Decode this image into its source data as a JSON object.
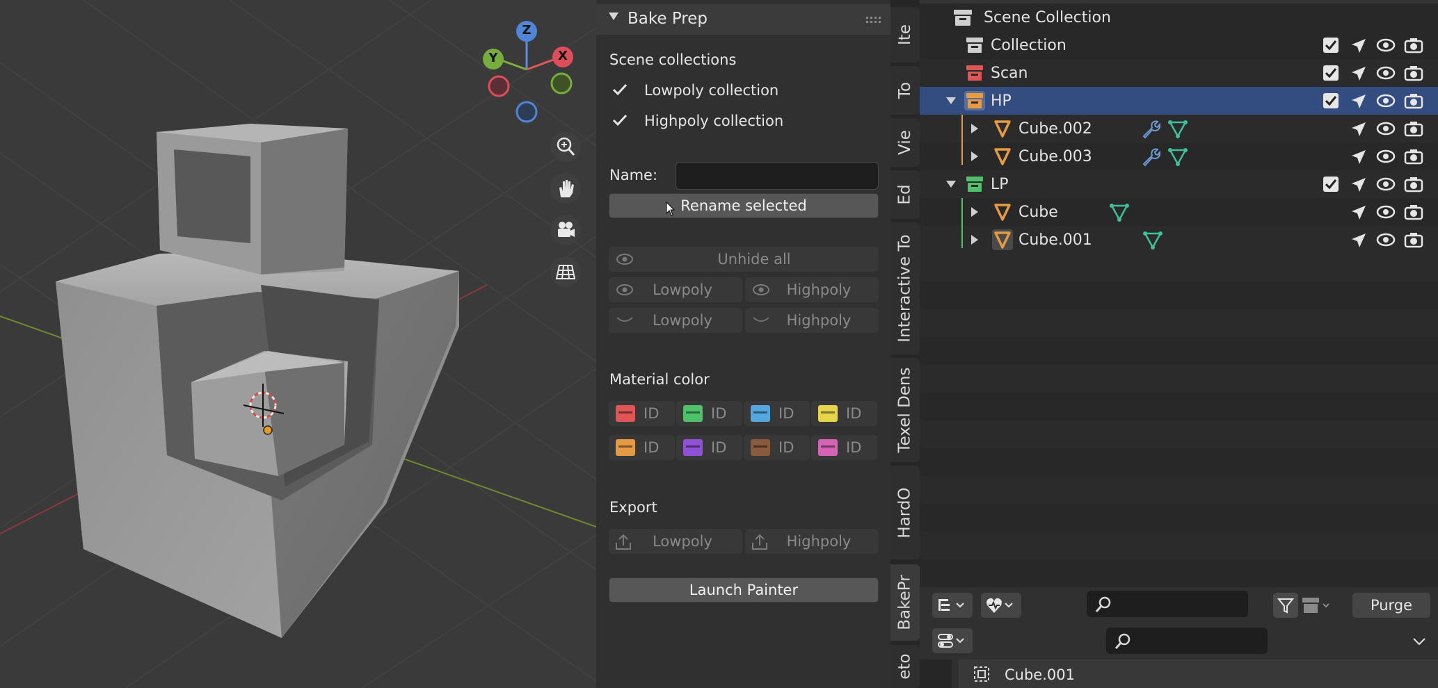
{
  "panel": {
    "title": "Bake Prep",
    "scene_collections_label": "Scene collections",
    "lowpoly_collection": "Lowpoly collection",
    "highpoly_collection": "Highpoly collection",
    "name_label": "Name:",
    "name_value": "",
    "rename_button": "Rename selected",
    "unhide_all": "Unhide all",
    "show_lowpoly": "Lowpoly",
    "show_highpoly": "Highpoly",
    "hide_lowpoly": "Lowpoly",
    "hide_highpoly": "Highpoly",
    "material_color_label": "Material color",
    "id_label": "ID",
    "material_colors": [
      "#e05555",
      "#4fc16a",
      "#55a7e0",
      "#e6d44a",
      "#e79a44",
      "#8f52d6",
      "#8a5a3c",
      "#d664b5"
    ],
    "export_label": "Export",
    "export_lowpoly": "Lowpoly",
    "export_highpoly": "Highpoly",
    "launch_button": "Launch Painter"
  },
  "tabs": [
    "Ite",
    "To",
    "Vie",
    "Ed",
    "Interactive To",
    "Texel Dens",
    "HardO",
    "BakePr",
    "eto"
  ],
  "outliner": {
    "scene_collection": "Scene Collection",
    "rows": [
      {
        "name": "Collection",
        "kind": "collection",
        "color": "#cfcfcf"
      },
      {
        "name": "Scan",
        "kind": "collection",
        "color": "#e05555"
      },
      {
        "name": "HP",
        "kind": "collection",
        "color": "#e79a44",
        "selected": true
      },
      {
        "name": "Cube.002",
        "kind": "mesh",
        "color": "#e79a44"
      },
      {
        "name": "Cube.003",
        "kind": "mesh",
        "color": "#e79a44"
      },
      {
        "name": "LP",
        "kind": "collection",
        "color": "#4fc16a"
      },
      {
        "name": "Cube",
        "kind": "mesh",
        "color": "#e79a44"
      },
      {
        "name": "Cube.001",
        "kind": "mesh",
        "color": "#e79a44"
      }
    ],
    "purge_button": "Purge",
    "search_value": "",
    "properties_object": "Cube.001"
  },
  "gizmo": {
    "z": "Z",
    "y": "Y",
    "x": "X"
  }
}
